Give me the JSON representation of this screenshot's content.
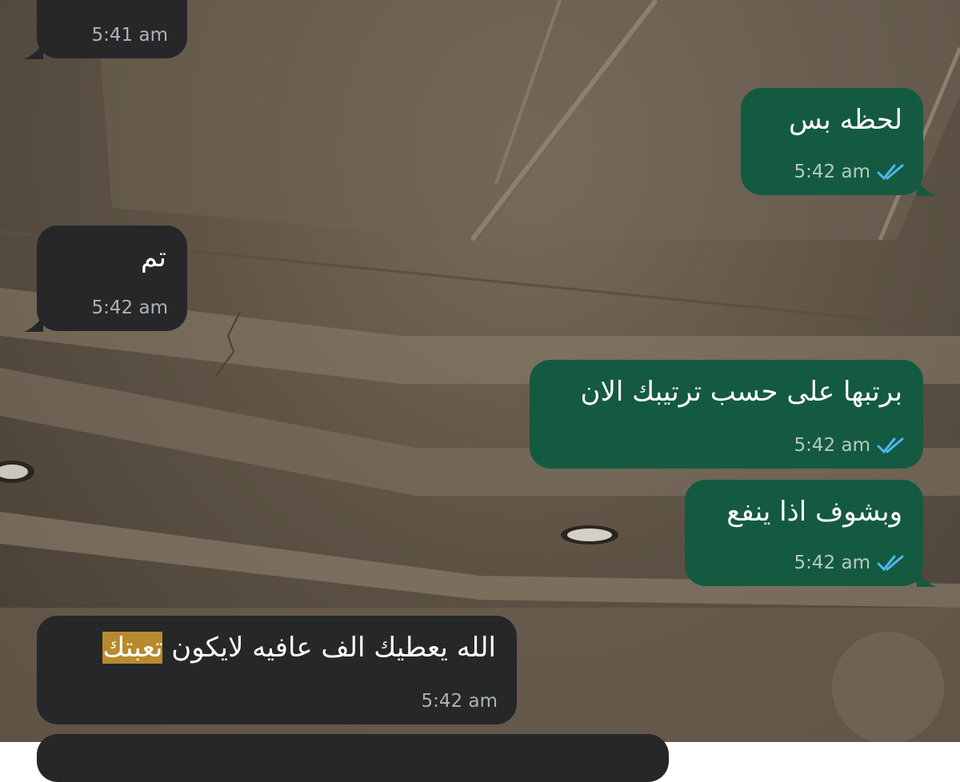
{
  "colors": {
    "incoming_bubble": "#262729",
    "outgoing_bubble": "#145a41",
    "read_ticks": "#4fb6ec",
    "highlight": "#b88a2e"
  },
  "messages": [
    {
      "direction": "incoming",
      "text": "",
      "time": "5:41 am"
    },
    {
      "direction": "outgoing",
      "text": "لحظه بس",
      "time": "5:42 am",
      "status_icon": "double-check-read-icon"
    },
    {
      "direction": "incoming",
      "text": "تم",
      "time": "5:42 am"
    },
    {
      "direction": "outgoing",
      "text": "برتبها على حسب ترتيبك الان",
      "time": "5:42 am",
      "status_icon": "double-check-read-icon"
    },
    {
      "direction": "outgoing",
      "text": "وبشوف اذا ينفع",
      "time": "5:42 am",
      "status_icon": "double-check-read-icon"
    },
    {
      "direction": "incoming",
      "text_plain": "الله يعطيك الف عافيه لايكون ",
      "text_highlight": "تعبتك",
      "time": "5:42 am"
    }
  ]
}
